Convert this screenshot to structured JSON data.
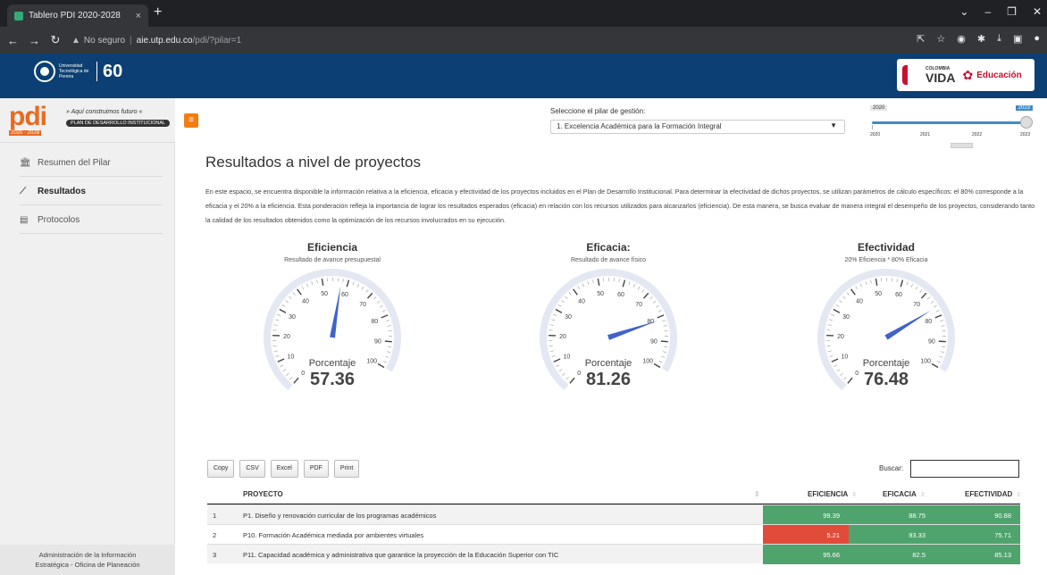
{
  "browser": {
    "tab_title": "Tablero PDI 2020-2028",
    "tab_close": "×",
    "new_tab": "+",
    "not_secure": "No seguro",
    "host": "aie.utp.edu.co",
    "path": "/pdi/?pilar=1",
    "window_controls": [
      "⌄",
      "–",
      "❐",
      "✕"
    ]
  },
  "banner": {
    "utp_name": "Universidad Tecnológica de Pereira",
    "anniversary": "60",
    "gov_country": "COLOMBIA",
    "gov_slogan": "VIDA",
    "gov_ministry": "Educación"
  },
  "header": {
    "logo_text": "pdi",
    "logo_years": "2020 · 2028",
    "slogan": "» Aquí construimos futuro «",
    "plan_name": "PLAN DE DESARROLLO INSTITUCIONAL",
    "menu_icon": "≡",
    "pilar_label": "Seleccione el pilar de gestión:",
    "pilar_selected": "1. Excelencia Académica para la Formación Integral",
    "slider": {
      "min_label": "2020",
      "max_label": "2023",
      "ticks": [
        "2020",
        "2021",
        "2022",
        "2023"
      ],
      "value": 2023
    }
  },
  "sidebar": {
    "items": [
      {
        "label": "Resumen del Pilar",
        "icon": "bank-icon"
      },
      {
        "label": "Resultados",
        "icon": "chart-line-icon"
      },
      {
        "label": "Protocolos",
        "icon": "document-icon"
      }
    ],
    "footer_line1": "Administración de la Información",
    "footer_line2": "Estratégica - Oficina de Planeación"
  },
  "main": {
    "title": "Resultados a nivel de proyectos",
    "description": "En este espacio, se encuentra disponible la información relativa a la eficiencia, eficacia y efectividad de los proyectos incluidos en el Plan de Desarrollo Institucional. Para determinar la efectividad de dichos proyectos, se utilizan parámetros de cálculo específicos: el 80% corresponde a la eficacia y el 20% a la eficiencia. Esta ponderación refleja la importancia de lograr los resultados esperados (eficacia) en relación con los recursos utilizados para alcanzarlos (eficiencia). De esta manera, se busca evaluar de manera integral el desempeño de los proyectos, considerando tanto la calidad de los resultados obtenidos como la optimización de los recursos involucrados en su ejecución."
  },
  "gauges": [
    {
      "title": "Eficiencia",
      "subtitle": "Resultado de avance presupuestal",
      "label": "Porcentaje",
      "value": "57.36",
      "numeric": 57.36
    },
    {
      "title": "Eficacia:",
      "subtitle": "Resultado de avance físico",
      "label": "Porcentaje",
      "value": "81.26",
      "numeric": 81.26
    },
    {
      "title": "Efectividad",
      "subtitle": "20% Eficiencia * 80% Eficacia",
      "label": "Porcentaje",
      "value": "76.48",
      "numeric": 76.48
    }
  ],
  "gauge_scale": [
    "0",
    "10",
    "20",
    "30",
    "40",
    "50",
    "60",
    "70",
    "80",
    "90",
    "100"
  ],
  "gauge_colors": {
    "needle": "#3f63c9",
    "band": "#e3e8f3"
  },
  "table": {
    "buttons": [
      "Copy",
      "CSV",
      "Excel",
      "PDF",
      "Print"
    ],
    "search_label": "Buscar:",
    "headers": [
      "PROYECTO",
      "EFICIENCIA",
      "EFICACIA",
      "EFECTIVIDAD"
    ],
    "rows": [
      {
        "n": "1",
        "proyecto": "P1. Diseño y renovación curricular de los programas académicos",
        "eficiencia": "99.39",
        "eficacia": "88.75",
        "efectividad": "90.88",
        "eff_color": "#4fa36c"
      },
      {
        "n": "2",
        "proyecto": "P10. Formación Académica mediada por ambientes virtuales",
        "eficiencia": "5.21",
        "eficacia": "93.33",
        "efectividad": "75.71",
        "eff_color": "#e04b3a"
      },
      {
        "n": "3",
        "proyecto": "P11. Capacidad académica y administrativa que garantice la proyección de la Educación Superior con TIC",
        "eficiencia": "95.66",
        "eficacia": "82.5",
        "efectividad": "85.13",
        "eff_color": "#4fa36c"
      }
    ],
    "good_color": "#4fa36c"
  }
}
